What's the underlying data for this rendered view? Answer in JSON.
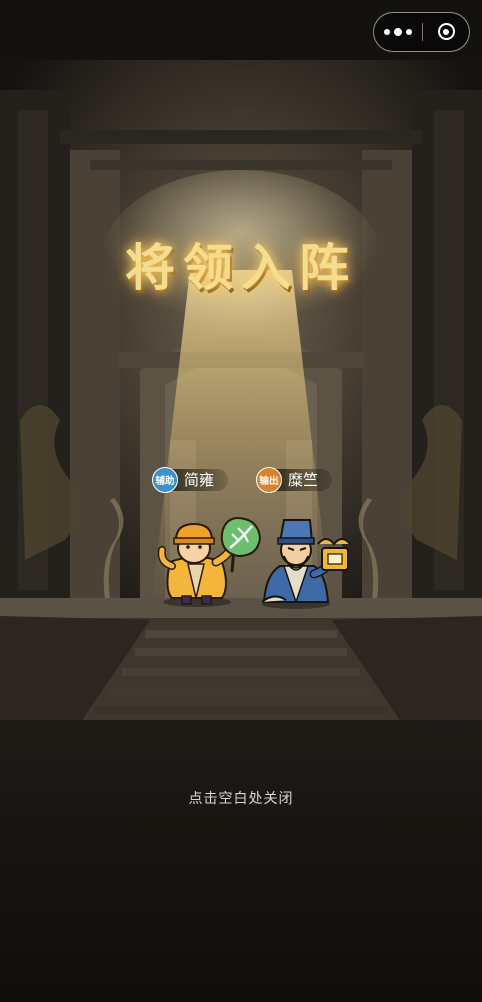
{
  "title": "将领入阵",
  "capsule": {
    "more_icon": "more-dots-icon",
    "close_icon": "target-close-icon"
  },
  "generals": [
    {
      "role_badge": "辅助",
      "name": "简雍",
      "badge_color": "#3e92c9"
    },
    {
      "role_badge": "输出",
      "name": "糜竺",
      "badge_color": "#d7842d"
    }
  ],
  "hint": "点击空白处关闭"
}
